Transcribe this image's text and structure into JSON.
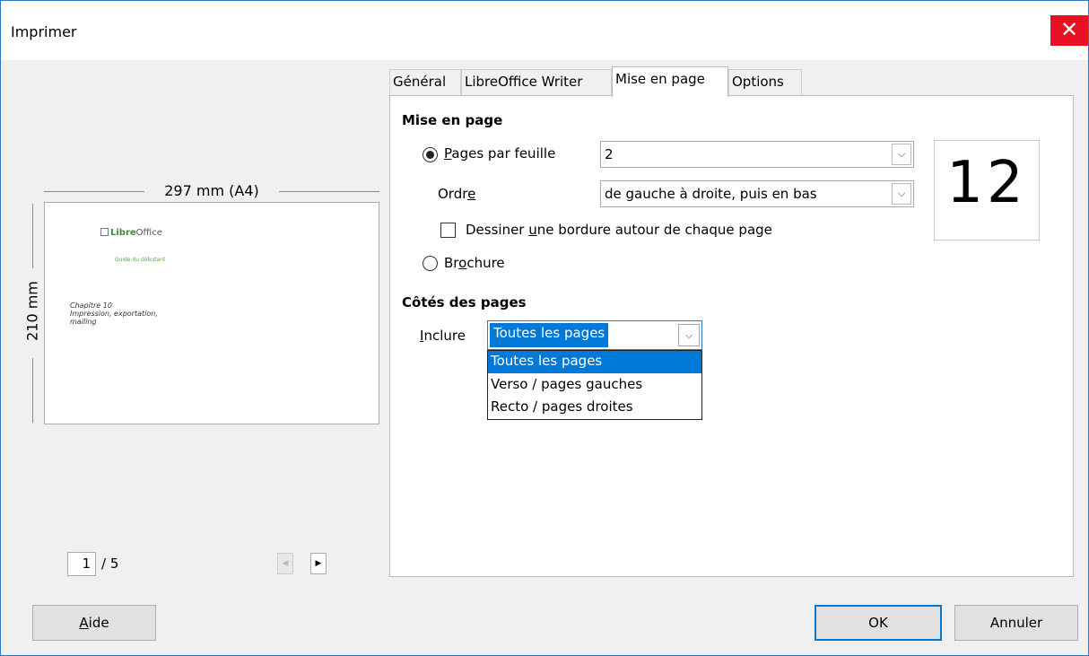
{
  "window": {
    "title": "Imprimer",
    "close_glyph": "✕"
  },
  "preview": {
    "width_label": "297 mm (A4)",
    "height_label": "210 mm",
    "logo_text_brand": "Libre",
    "logo_text_rest": "Office",
    "subtitle": "Guide du débutant",
    "chapter_line1": "Chapitre 10",
    "chapter_line2": "Impression, exportation,",
    "chapter_line3": "mailing",
    "current_page": "1",
    "total_pages": "/ 5",
    "prev_glyph": "◀",
    "next_glyph": "▶"
  },
  "tabs": [
    {
      "label": "Général"
    },
    {
      "label": "LibreOffice Writer"
    },
    {
      "label": "Mise en page",
      "active": true
    },
    {
      "label": "Options"
    }
  ],
  "layout": {
    "section_title": "Mise en page",
    "pages_per_sheet": {
      "label_u": "P",
      "label_rest": "ages par feuille",
      "value": "2"
    },
    "order": {
      "label_pre": "Ordr",
      "label_u": "e",
      "value": "de gauche à droite, puis en bas"
    },
    "border": {
      "label_pre": "Dessiner ",
      "label_u": "u",
      "label_rest": "ne bordure autour de chaque page"
    },
    "brochure": {
      "label_pre": "Br",
      "label_u": "o",
      "label_rest": "chure"
    },
    "preview_digits": "12"
  },
  "sides": {
    "section_title": "Côtés des pages",
    "include_u": "I",
    "include_rest": "nclure",
    "selected": "Toutes les pages",
    "options": [
      "Toutes les pages",
      "Verso / pages gauches",
      "Recto / pages droites"
    ]
  },
  "buttons": {
    "help_u": "A",
    "help_rest": "ide",
    "ok": "OK",
    "cancel": "Annuler"
  },
  "icons": {
    "dropdown_arrow": "⌵"
  }
}
